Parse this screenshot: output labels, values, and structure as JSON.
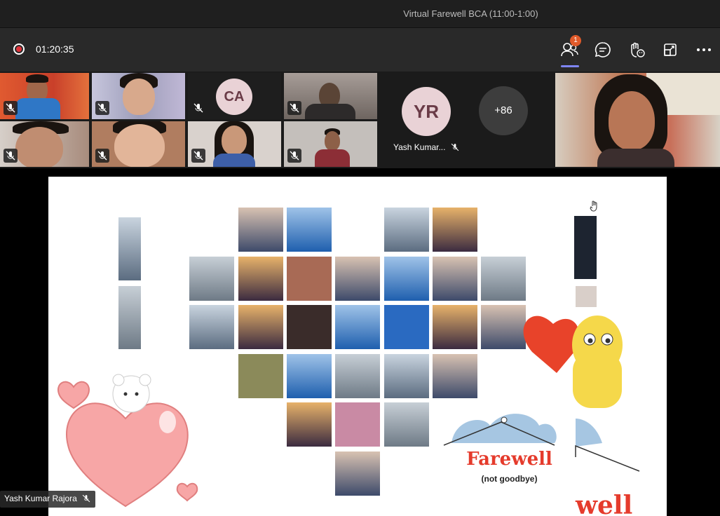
{
  "window": {
    "title": "Virtual Farewell BCA (11:00-1:00)"
  },
  "toolbar": {
    "recording_time": "01:20:35",
    "participants_badge": "1",
    "icons": [
      "record-icon",
      "participants-icon",
      "chat-icon",
      "reactions-icon",
      "share-tray-icon",
      "more-options-icon"
    ]
  },
  "participants": {
    "tiles": [
      {
        "initials": "CA"
      },
      {
        "initials": "YR",
        "name": "Yash Kumar..."
      },
      {
        "overflow": "+86"
      }
    ]
  },
  "presenter": {
    "name": "Yash Kumar Rajora"
  },
  "slide": {
    "farewell_title": "Farewell",
    "farewell_subtitle": "(not goodbye)",
    "partial_text": "well"
  },
  "colors": {
    "accent": "#7f85f5",
    "record": "#e0323a",
    "badge": "#e05a2a",
    "farewell_red": "#e53b2c"
  }
}
